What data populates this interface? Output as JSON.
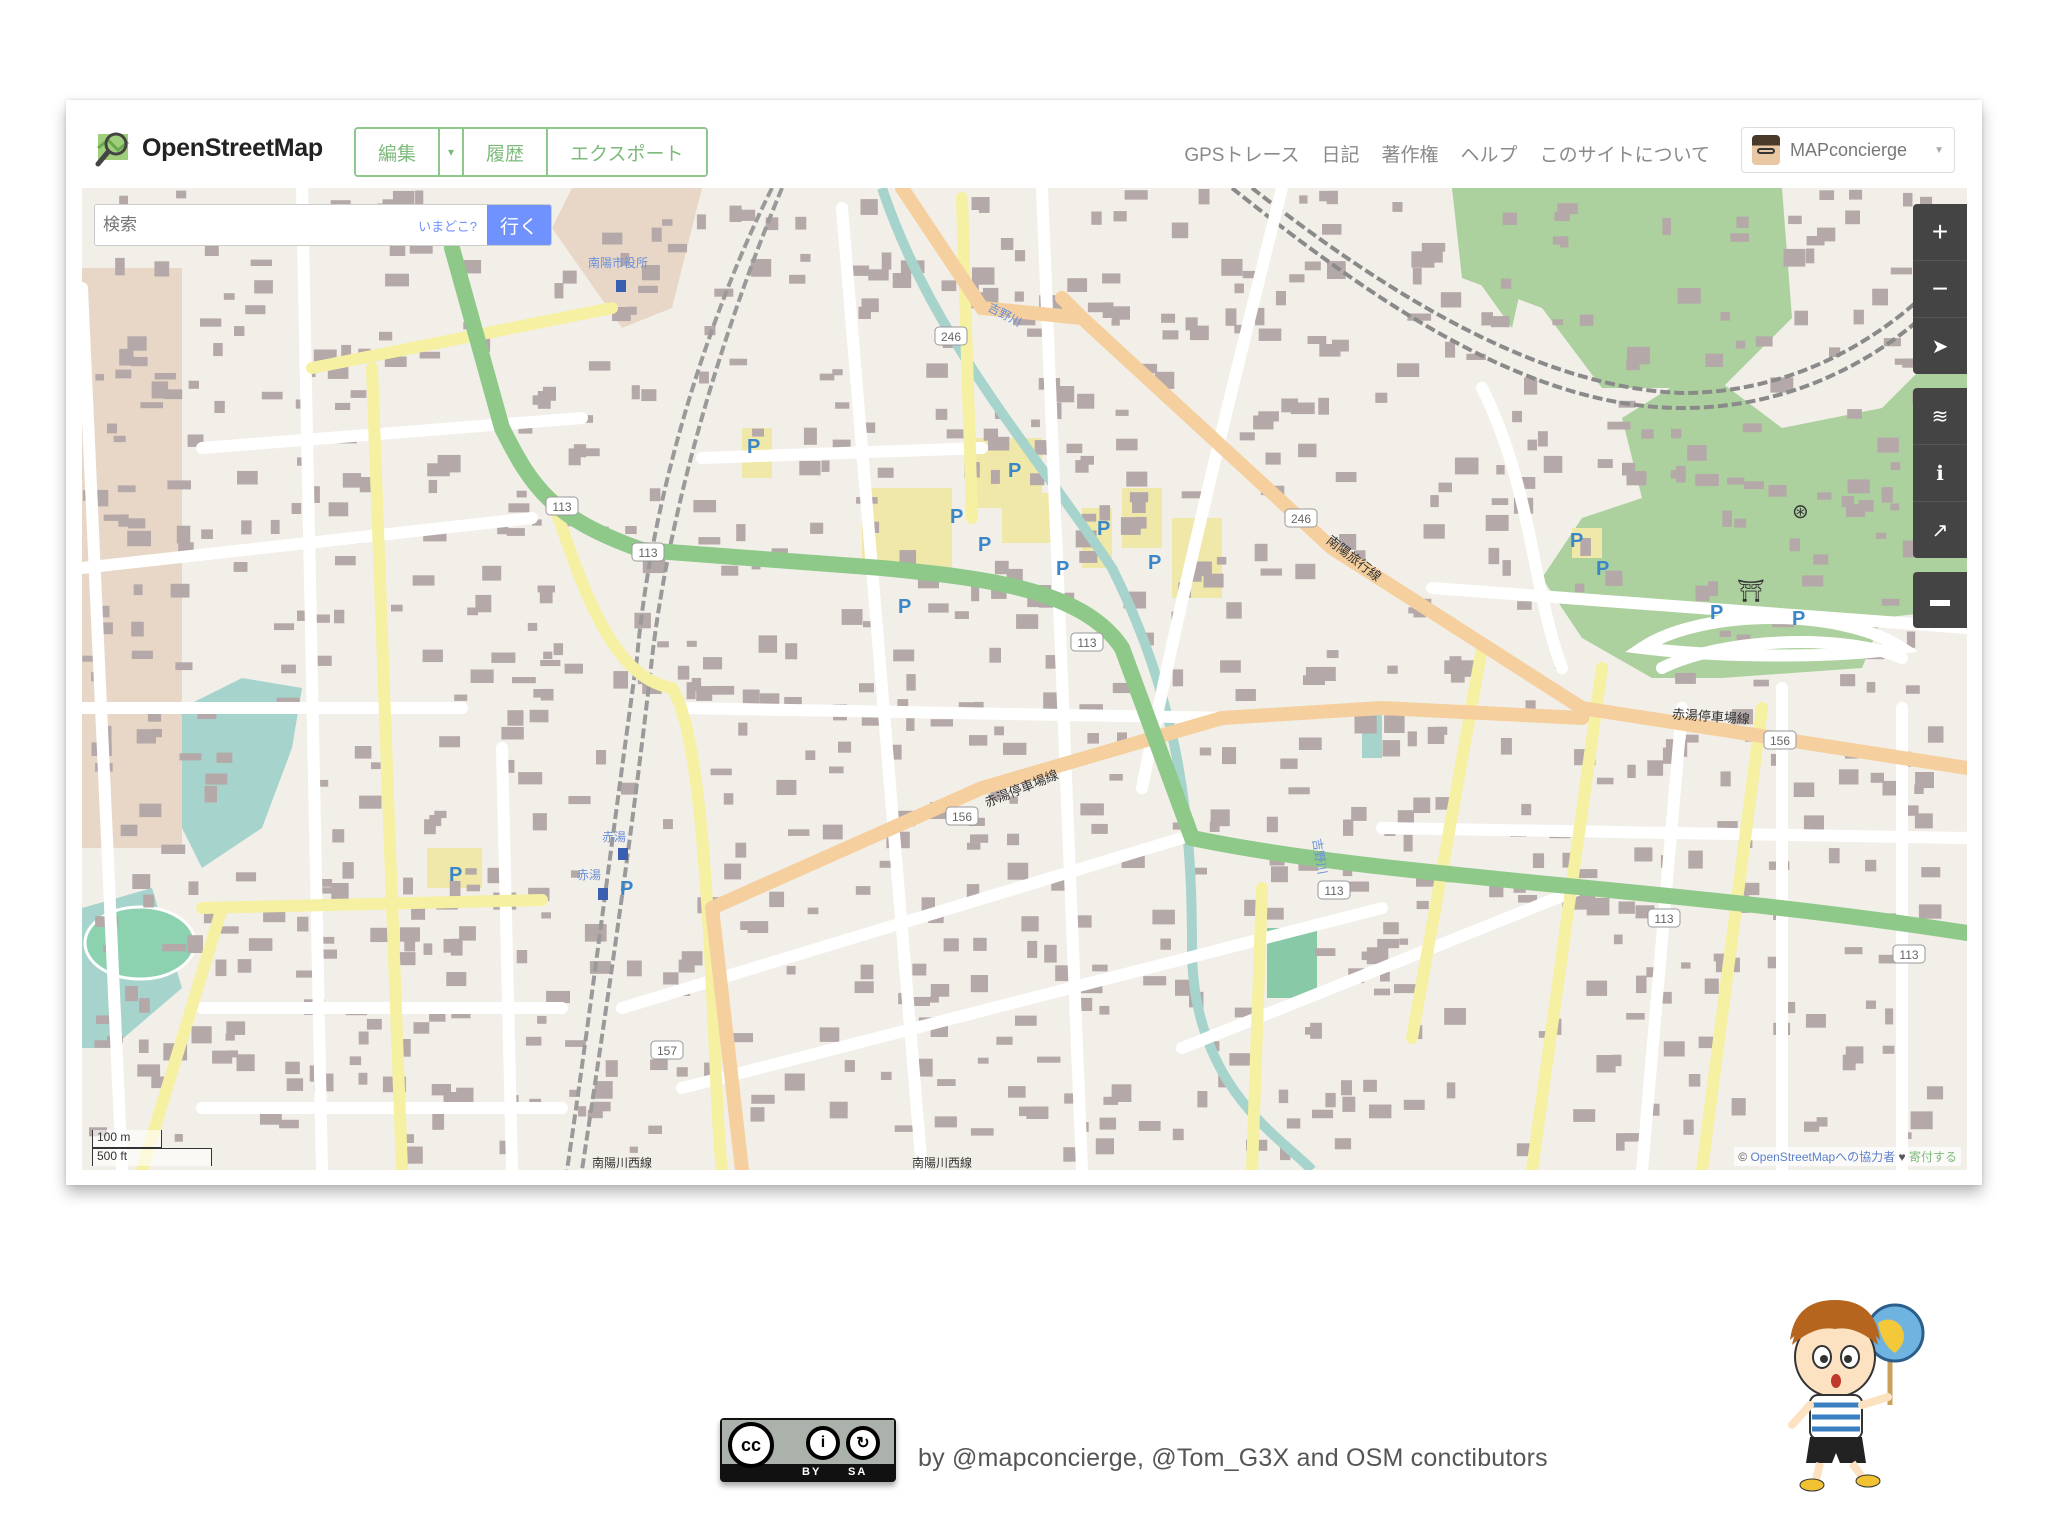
{
  "header": {
    "brand": "OpenStreetMap",
    "edit_button": "編集",
    "history_button": "履歴",
    "export_button": "エクスポート",
    "nav": [
      "GPSトレース",
      "日記",
      "著作権",
      "ヘルプ",
      "このサイトについて"
    ],
    "username": "MAPconcierge"
  },
  "search": {
    "placeholder": "検索",
    "where_am_i": "いまどこ?",
    "go_button": "行く"
  },
  "map_controls": [
    "zoom-in",
    "zoom-out",
    "geolocate",
    "layers",
    "info",
    "share",
    "note"
  ],
  "map_labels": {
    "city_hall": "南陽市役所",
    "station1": "赤湯",
    "station2": "赤湯",
    "river": "吉野川",
    "river2": "吉野川",
    "road_akayu_station": "赤湯停車場線",
    "road_akayu_station2": "赤湯停車場線",
    "road_nanyo": "南陽旅行線",
    "road_bottom1": "南陽川西線",
    "road_bottom2": "南陽川西線",
    "route_113_a": "113",
    "route_113_b": "113",
    "route_113_c": "113",
    "route_113_d": "113",
    "route_113_e": "113",
    "route_113_f": "113",
    "route_113_g": "113",
    "route_246_a": "246",
    "route_246_b": "246",
    "route_156_a": "156",
    "route_156_b": "156",
    "route_157": "157",
    "parking": "P"
  },
  "scale": {
    "metric": "100 m",
    "imperial": "500 ft"
  },
  "attribution": {
    "prefix": "©",
    "link": "OpenStreetMapへの協力者",
    "heart": "♥",
    "donate": "寄付する"
  },
  "license": {
    "cc": "cc",
    "by": "BY",
    "sa": "SA"
  },
  "credit": "by @mapconcierge, @Tom_G3X and OSM conctibutors",
  "colors": {
    "osm_green": "#7eba7b",
    "primary_road": "#8fc98a",
    "secondary_road": "#f5cf9e",
    "tertiary_road": "#f7f3b0",
    "building": "#a8999a",
    "water": "#a6d4cc",
    "parking": "#f0e8a9",
    "parking_symbol": "#3a86c8",
    "go_button": "#7092ff"
  }
}
